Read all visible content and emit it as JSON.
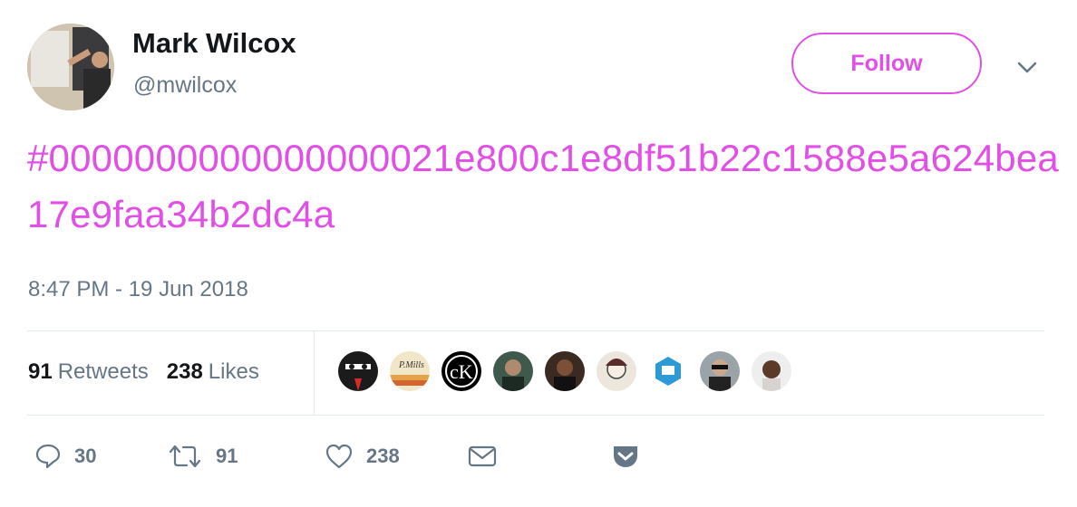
{
  "user": {
    "display_name": "Mark Wilcox",
    "handle": "@mwilcox"
  },
  "header": {
    "follow_label": "Follow",
    "menu_icon": "chevron-down-icon"
  },
  "tweet": {
    "text": "#0000000000000000021e800c1e8df51b22c1588e5a624bea17e9faa34b2dc4a",
    "timestamp": "8:47 PM - 19 Jun 2018"
  },
  "stats": {
    "retweets_count": "91",
    "retweets_label": "Retweets",
    "likes_count": "238",
    "likes_label": "Likes"
  },
  "actions": {
    "reply_count": "30",
    "retweet_count": "91",
    "like_count": "238"
  },
  "colors": {
    "accent": "#e14fe6",
    "secondary_text": "#657786",
    "divider": "#e1e8ed"
  }
}
